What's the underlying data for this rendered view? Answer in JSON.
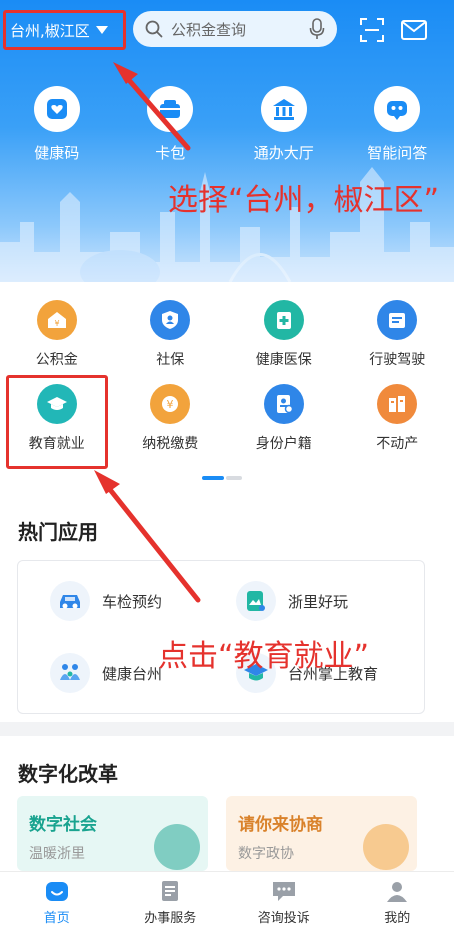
{
  "topbar": {
    "city": "台州,椒江区",
    "search_placeholder": "公积金查询"
  },
  "hero_items": [
    {
      "label": "健康码",
      "icon": "heart-shield-icon"
    },
    {
      "label": "卡包",
      "icon": "card-bag-icon"
    },
    {
      "label": "通办大厅",
      "icon": "government-hall-icon"
    },
    {
      "label": "智能问答",
      "icon": "robot-icon"
    }
  ],
  "services": [
    {
      "label": "公积金",
      "icon": "house-fund-icon",
      "color": "#f2a33c"
    },
    {
      "label": "社保",
      "icon": "social-security-icon",
      "color": "#2f86e8"
    },
    {
      "label": "健康医保",
      "icon": "medical-insurance-icon",
      "color": "#22b7a4"
    },
    {
      "label": "行驶驾驶",
      "icon": "driving-license-icon",
      "color": "#2f86e8"
    },
    {
      "label": "教育就业",
      "icon": "graduation-cap-icon",
      "color": "#22b7b7"
    },
    {
      "label": "纳税缴费",
      "icon": "tax-payment-icon",
      "color": "#f2a33c"
    },
    {
      "label": "身份户籍",
      "icon": "id-card-icon",
      "color": "#2f86e8"
    },
    {
      "label": "不动产",
      "icon": "real-estate-icon",
      "color": "#f08a3c"
    }
  ],
  "hot_apps": {
    "title": "热门应用",
    "items": [
      {
        "label": "车检预约",
        "icon": "car-icon"
      },
      {
        "label": "浙里好玩",
        "icon": "landscape-icon"
      },
      {
        "label": "健康台州",
        "icon": "family-icon"
      },
      {
        "label": "台州掌上教育",
        "icon": "education-cap-icon"
      }
    ]
  },
  "reform": {
    "title": "数字化改革",
    "cards": [
      {
        "title": "数字社会",
        "subtitle": "温暖浙里",
        "color": "#19a38f",
        "bg": "#e6f7f4"
      },
      {
        "title": "请你来协商",
        "subtitle": "数字政协",
        "color": "#d9822b",
        "bg": "#fdf1e4"
      }
    ]
  },
  "tabs": [
    {
      "label": "首页",
      "icon": "home-icon",
      "active": true
    },
    {
      "label": "办事服务",
      "icon": "service-list-icon",
      "active": false
    },
    {
      "label": "咨询投诉",
      "icon": "chat-bubble-icon",
      "active": false
    },
    {
      "label": "我的",
      "icon": "user-icon",
      "active": false
    }
  ],
  "annotations": {
    "select_city": "选择“台州，椒江区”",
    "click_education": "点击“教育就业”"
  },
  "colors": {
    "primary": "#1a8cf5",
    "annotation": "#e5322d"
  }
}
